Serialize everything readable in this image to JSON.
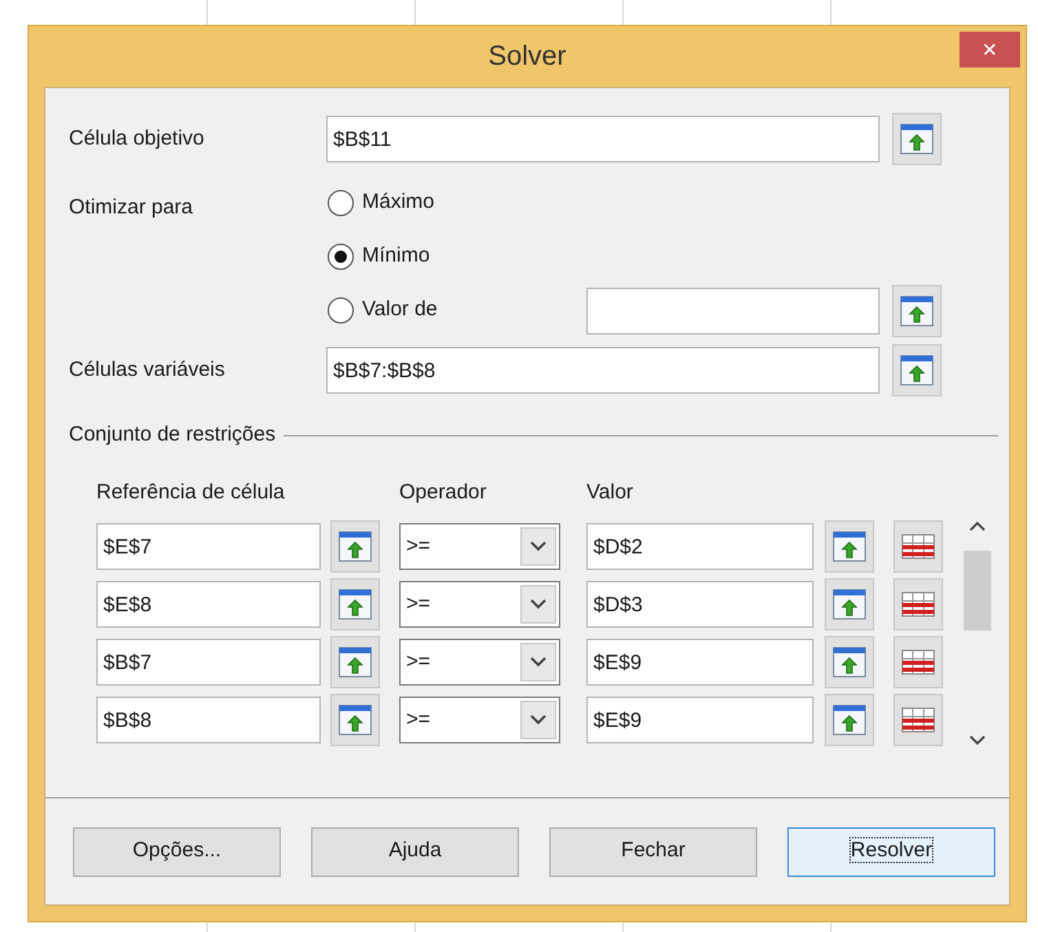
{
  "window": {
    "title": "Solver",
    "close": "✕"
  },
  "objective": {
    "label": "Célula objetivo",
    "value": "$B$11"
  },
  "optimize": {
    "label": "Otimizar para",
    "options": [
      {
        "label": "Máximo",
        "selected": false
      },
      {
        "label": "Mínimo",
        "selected": true
      },
      {
        "label": "Valor de",
        "selected": false,
        "kind": "value"
      }
    ]
  },
  "variable_cells": {
    "label": "Células variáveis",
    "value": "$B$7:$B$8"
  },
  "constraints": {
    "label": "Conjunto de restrições",
    "columns": [
      "Referência de célula",
      "Operador",
      "Valor"
    ],
    "rows": [
      {
        "reference": "$E$7",
        "operator": ">=",
        "value": "$D$2"
      },
      {
        "reference": "$E$8",
        "operator": ">=",
        "value": "$D$3"
      },
      {
        "reference": "$B$7",
        "operator": ">=",
        "value": "$E$9"
      },
      {
        "reference": "$B$8",
        "operator": ">=",
        "value": "$E$9"
      }
    ]
  },
  "buttons": [
    {
      "label": "Opções...",
      "focused": false
    },
    {
      "label": "Ajuda",
      "focused": false
    },
    {
      "label": "Fechar",
      "focused": false
    },
    {
      "label": "Resolver",
      "focused": true
    }
  ]
}
